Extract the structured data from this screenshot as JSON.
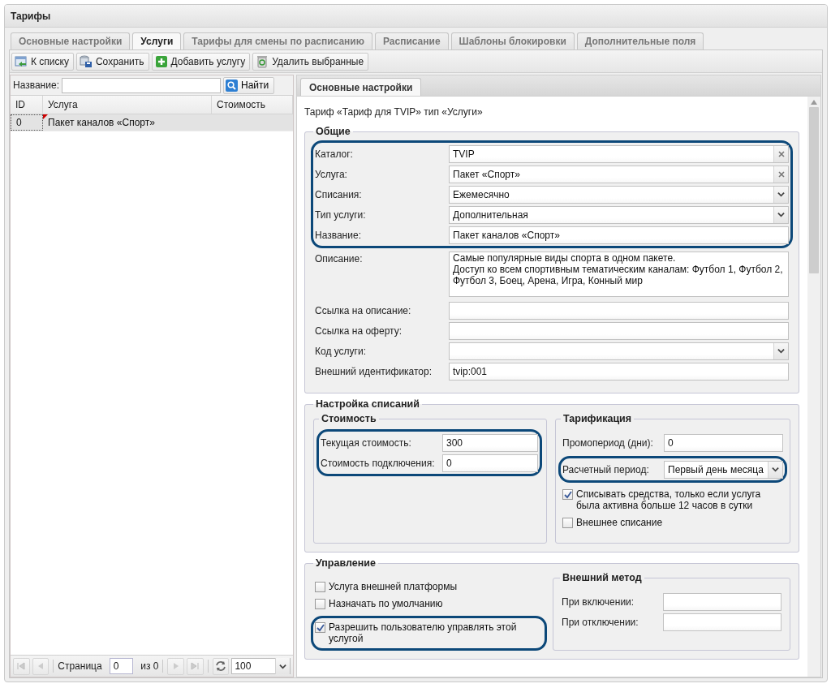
{
  "window": {
    "title": "Тарифы"
  },
  "tabs": [
    {
      "label": "Основные настройки",
      "selected": false
    },
    {
      "label": "Услуги",
      "selected": true
    },
    {
      "label": "Тарифы для смены по расписанию",
      "selected": false
    },
    {
      "label": "Расписание",
      "selected": false
    },
    {
      "label": "Шаблоны блокировки",
      "selected": false
    },
    {
      "label": "Дополнительные поля",
      "selected": false
    }
  ],
  "toolbar": [
    {
      "label": "К списку",
      "kind": "back"
    },
    {
      "label": "Сохранить",
      "kind": "save"
    },
    {
      "label": "Добавить услугу",
      "kind": "add"
    },
    {
      "label": "Удалить выбранные",
      "kind": "delete"
    }
  ],
  "search": {
    "label": "Название:",
    "button": "Найти"
  },
  "grid": {
    "columns": [
      "ID",
      "Услуга",
      "Стоимость"
    ],
    "rows": [
      {
        "id": "0",
        "service": "Пакет каналов «Спорт»",
        "selected": true,
        "modified": true
      }
    ]
  },
  "pager": {
    "page_label": "Страница",
    "page": "0",
    "of": "из 0",
    "page_size": "100"
  },
  "detail_tabs": [
    {
      "label": "Основные настройки",
      "selected": true
    }
  ],
  "heading": "Тариф «Тариф для TVIP» тип «Услуги»",
  "general": {
    "legend": "Общие",
    "blocks": [
      {
        "highlighted": true,
        "items": [
          {
            "kind": "clear",
            "label": "Каталог:",
            "value": "TVIP"
          },
          {
            "kind": "clear",
            "label": "Услуга:",
            "value": "Пакет «Спорт»"
          },
          {
            "kind": "combo",
            "label": "Списания:",
            "value": "Ежемесячно"
          },
          {
            "kind": "combo",
            "label": "Тип услуги:",
            "value": "Дополнительная"
          },
          {
            "kind": "text",
            "label": "Название:",
            "value": "Пакет каналов «Спорт»"
          }
        ]
      },
      {
        "highlighted": false,
        "items": [
          {
            "kind": "textarea",
            "label": "Описание:",
            "lines": [
              "Самые популярные виды спорта в одном пакете.",
              "Доступ ко всем спортивным тематическим каналам: Футбол 1, Футбол 2,",
              "Футбол 3, Боец, Арена, Игра, Конный мир"
            ]
          },
          {
            "kind": "text",
            "label": "Ссылка на описание:"
          },
          {
            "kind": "text",
            "label": "Ссылка на оферту:"
          },
          {
            "kind": "combo",
            "label": "Код услуги:"
          },
          {
            "kind": "text",
            "label": "Внешний идентификатор:",
            "value": "tvip:001"
          }
        ]
      }
    ]
  },
  "charges": {
    "legend": "Настройка списаний",
    "cost": {
      "legend": "Стоимость",
      "blocks": [
        {
          "highlighted": true,
          "items": [
            {
              "kind": "text",
              "label": "Текущая стоимость:",
              "value": "300"
            },
            {
              "kind": "text",
              "label": "Стоимость подключения:",
              "value": "0"
            }
          ]
        }
      ]
    },
    "tariffing": {
      "legend": "Тарификация",
      "blocks": [
        {
          "highlighted": false,
          "items": [
            {
              "kind": "text",
              "label": "Промопериод (дни):",
              "value": "0"
            }
          ]
        },
        {
          "highlighted": true,
          "items": [
            {
              "kind": "combo",
              "label": "Расчетный период:",
              "value": "Первый день месяца"
            }
          ]
        },
        {
          "highlighted": false,
          "items": [
            {
              "kind": "checkbox",
              "label": "Списывать средства, только если услуга была активна больше 12 часов в сутки",
              "checked": true
            },
            {
              "kind": "checkbox",
              "label": "Внешнее списание",
              "checked": false
            }
          ]
        }
      ]
    }
  },
  "management": {
    "legend": "Управление",
    "blocks": [
      {
        "highlighted": false,
        "items": [
          {
            "kind": "checkbox",
            "label": "Услуга внешней платформы",
            "checked": false
          },
          {
            "kind": "checkbox",
            "label": "Назначать по умолчанию",
            "checked": false
          }
        ]
      },
      {
        "highlighted": true,
        "items": [
          {
            "kind": "checkbox",
            "label": "Разрешить пользователю управлять этой услугой",
            "checked": true
          }
        ]
      }
    ],
    "external_method": {
      "legend": "Внешний метод",
      "blocks": [
        {
          "highlighted": false,
          "items": [
            {
              "kind": "text",
              "label": "При включении:"
            },
            {
              "kind": "text",
              "label": "При отключении:"
            }
          ]
        }
      ]
    }
  }
}
